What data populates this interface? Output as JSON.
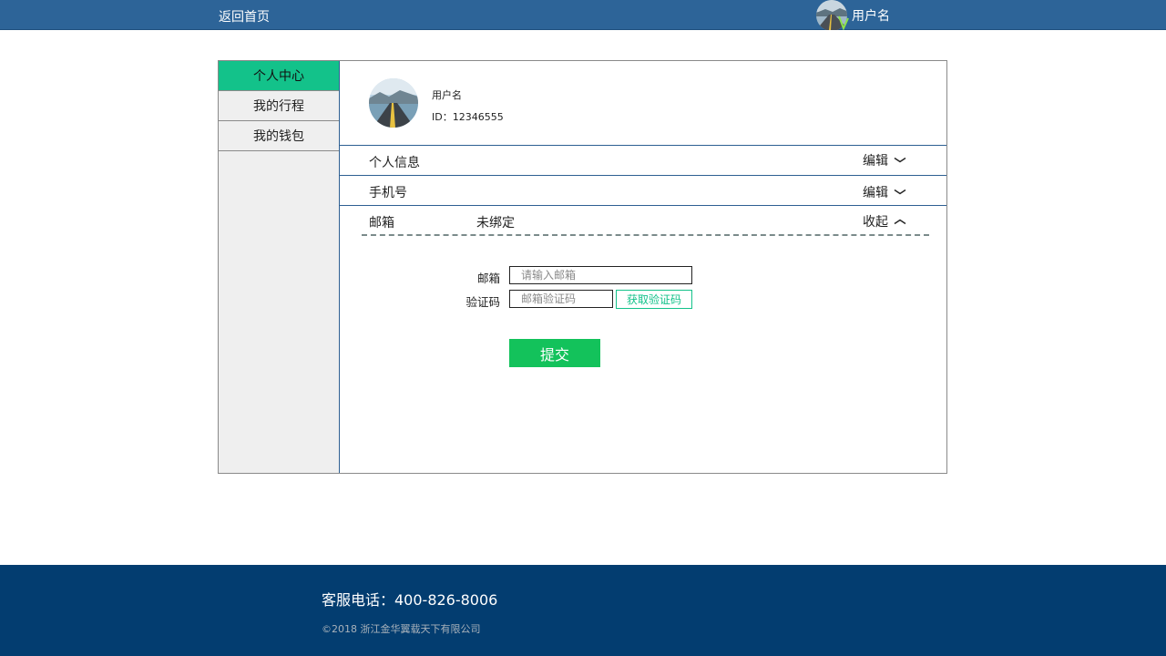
{
  "header": {
    "back_home": "返回首页",
    "username": "用户名"
  },
  "sidebar": {
    "items": [
      {
        "label": "个人中心",
        "active": true
      },
      {
        "label": "我的行程",
        "active": false
      },
      {
        "label": "我的钱包",
        "active": false
      }
    ]
  },
  "profile": {
    "name": "用户名",
    "id_text": "ID：12346555"
  },
  "sections": [
    {
      "label": "个人信息",
      "value": "",
      "action": "编辑",
      "icon": "chevron-down-icon"
    },
    {
      "label": "手机号",
      "value": "",
      "action": "编辑",
      "icon": "chevron-down-icon"
    },
    {
      "label": "邮箱",
      "value": "未绑定",
      "action": "收起",
      "icon": "chevron-up-icon"
    }
  ],
  "email_form": {
    "email_label": "邮箱",
    "email_placeholder": "请输入邮箱",
    "code_label": "验证码",
    "code_placeholder": "邮箱验证码",
    "get_code_label": "获取验证码",
    "submit_label": "提交"
  },
  "footer": {
    "phone": "客服电话：400-826-8006",
    "copyright": "©2018 浙江金华翼载天下有限公司"
  },
  "colors": {
    "header_bg": "#2d6498",
    "footer_bg": "#033d70",
    "accent_green": "#13c28a",
    "submit_green": "#13c25b"
  }
}
